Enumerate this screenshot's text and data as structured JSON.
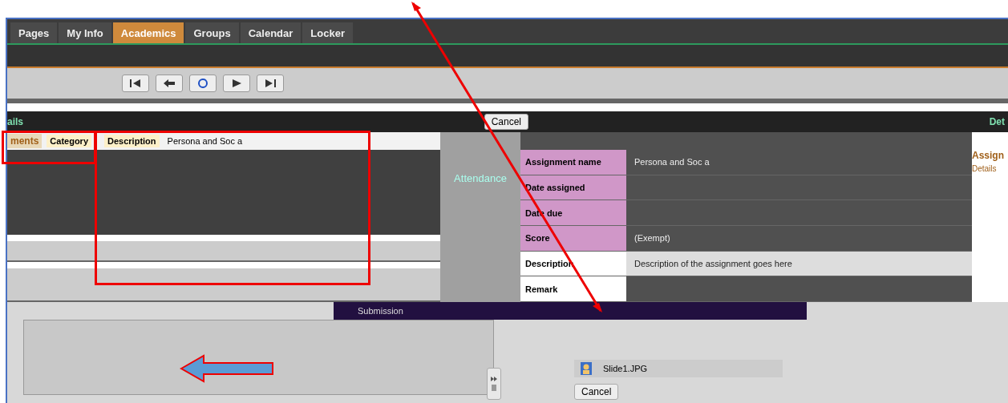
{
  "tabs": [
    {
      "label": "Pages",
      "selected": false
    },
    {
      "label": "My Info",
      "selected": false
    },
    {
      "label": "Academics",
      "selected": true
    },
    {
      "label": "Groups",
      "selected": false
    },
    {
      "label": "Calendar",
      "selected": false
    },
    {
      "label": "Locker",
      "selected": false
    }
  ],
  "toolbar": {
    "cancel_button": "Cancel"
  },
  "header_fragments": {
    "left": "ails",
    "right": "Det"
  },
  "assignments": {
    "heading": "ments",
    "columns": [
      "Category",
      "Description"
    ],
    "description": "Persona and Soc a"
  },
  "attendance_label": "Attendance",
  "details": {
    "fields": [
      {
        "label": "Assignment name",
        "value": "Persona and Soc a"
      },
      {
        "label": "Date assigned"
      },
      {
        "label": "Date due"
      },
      {
        "label": "Score",
        "value": "(Exempt)"
      },
      {
        "label": "Description",
        "value": "Description of the assignment goes here"
      },
      {
        "label": "Remark"
      }
    ]
  },
  "side_panel": {
    "heading": "Assign",
    "link": "Details"
  },
  "submission_label": "Submission",
  "files": [
    {
      "name": "Slide1.JPG"
    }
  ],
  "cancel_button": "Cancel"
}
